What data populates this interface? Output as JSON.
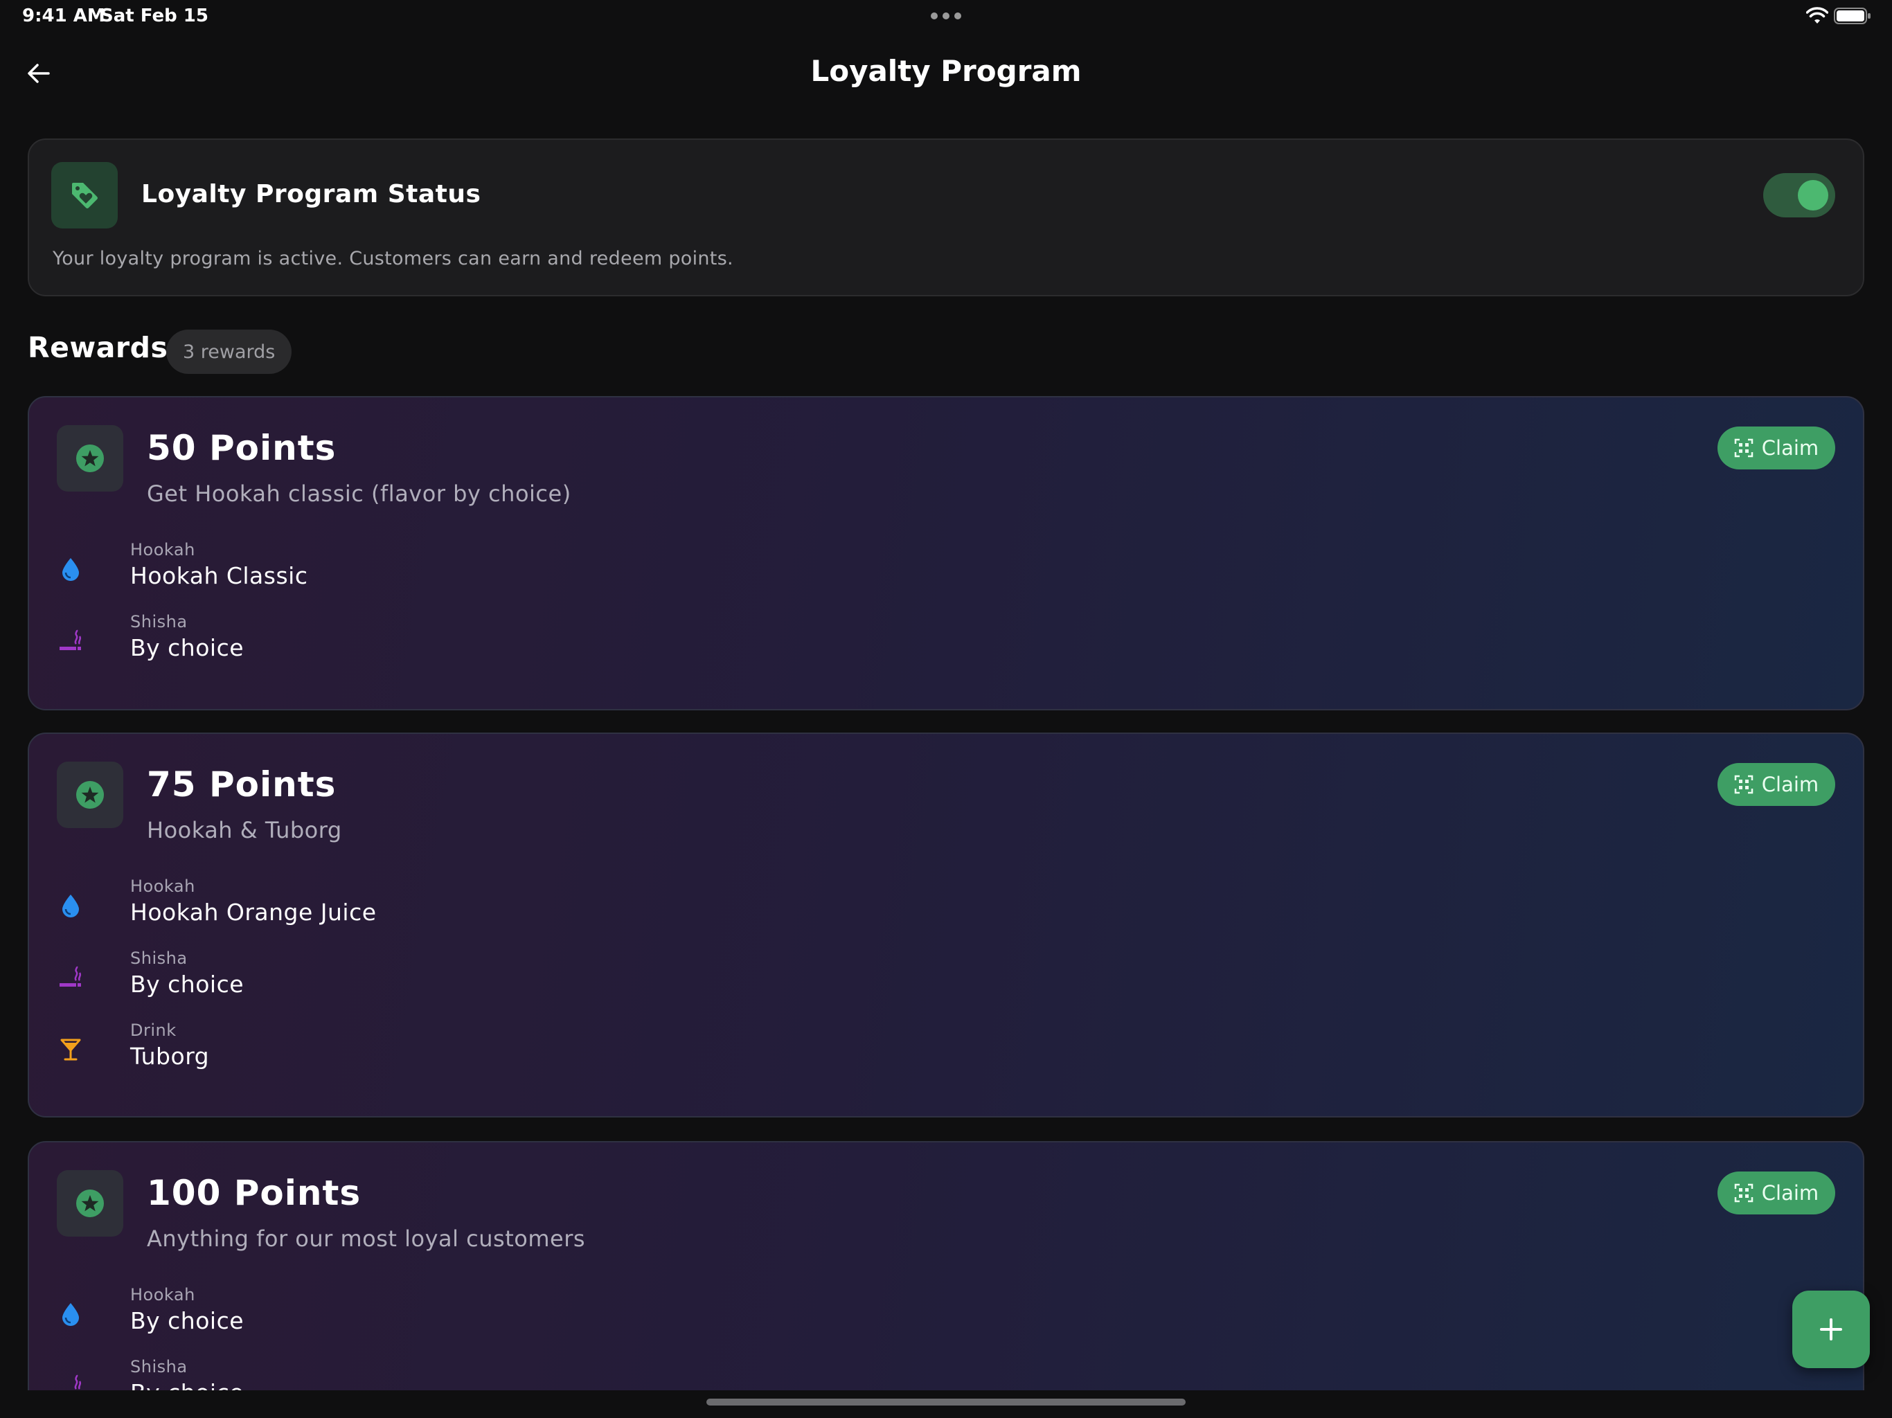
{
  "status_bar": {
    "time": "9:41 AM",
    "date": "Sat Feb 15"
  },
  "header": {
    "title": "Loyalty Program",
    "back_icon": "arrow-left-icon"
  },
  "status_card": {
    "icon": "tag-heart-icon",
    "title": "Loyalty Program Status",
    "description": "Your loyalty program is active. Customers can earn and redeem points.",
    "toggle_on": true
  },
  "rewards": {
    "heading": "Rewards",
    "count_label": "3 rewards",
    "items": [
      {
        "title": "50 Points",
        "description": "Get Hookah classic (flavor by choice)",
        "claim_label": "Claim",
        "lines": [
          {
            "icon": "drop-icon",
            "label": "Hookah",
            "value": "Hookah Classic"
          },
          {
            "icon": "smoking-icon",
            "label": "Shisha",
            "value": "By choice"
          }
        ]
      },
      {
        "title": "75 Points",
        "description": "Hookah & Tuborg",
        "claim_label": "Claim",
        "lines": [
          {
            "icon": "drop-icon",
            "label": "Hookah",
            "value": "Hookah Orange Juice"
          },
          {
            "icon": "smoking-icon",
            "label": "Shisha",
            "value": "By choice"
          },
          {
            "icon": "cocktail-icon",
            "label": "Drink",
            "value": "Tuborg"
          }
        ]
      },
      {
        "title": "100 Points",
        "description": "Anything for our most loyal customers",
        "claim_label": "Claim",
        "lines": [
          {
            "icon": "drop-icon",
            "label": "Hookah",
            "value": "By choice"
          },
          {
            "icon": "smoking-icon",
            "label": "Shisha",
            "value": "By choice"
          }
        ]
      }
    ]
  },
  "fab": {
    "icon": "plus-icon"
  },
  "colors": {
    "accent_green": "#3e9e64",
    "drop_blue": "#2a8ff0",
    "shisha_purple": "#a038c8",
    "drink_orange": "#f2a01c"
  }
}
